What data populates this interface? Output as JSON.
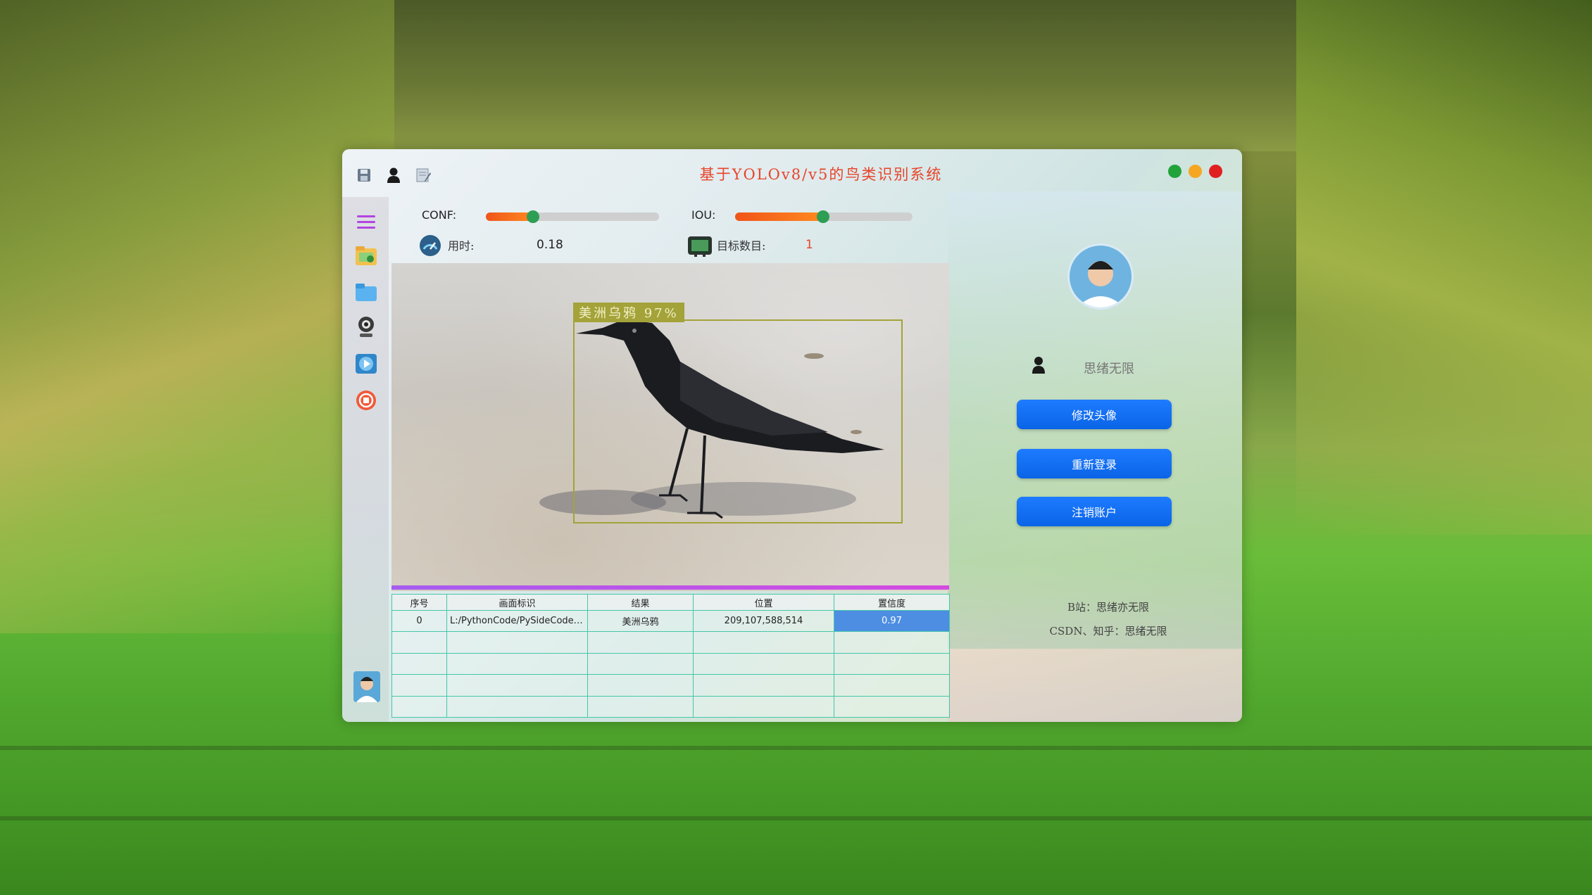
{
  "window": {
    "title": "基于YOLOv8/v5的鸟类识别系统",
    "controls": {
      "green": "#21a33a",
      "yellow": "#f5a623",
      "red": "#e02020"
    }
  },
  "toolbar": {
    "icons": [
      "save-icon",
      "user-icon",
      "edit-icon"
    ]
  },
  "sidebar": {
    "items": [
      "menu-icon",
      "image-folder-icon",
      "folder-icon",
      "webcam-icon",
      "video-play-icon",
      "stop-icon"
    ]
  },
  "params": {
    "conf_label": "CONF:",
    "conf_value": 0.25,
    "iou_label": "IOU:",
    "iou_value": 0.5
  },
  "stats": {
    "time_label": "用时:",
    "time_value": "0.18",
    "count_label": "目标数目:",
    "count_value": "1"
  },
  "detection": {
    "label": "美洲乌鸦 97%",
    "box_color": "#a3a33a"
  },
  "table": {
    "headers": [
      "序号",
      "画面标识",
      "结果",
      "位置",
      "置信度"
    ],
    "rows": [
      [
        "0",
        "L:/PythonCode/PySideCode/...",
        "美洲乌鸦",
        "209,107,588,514",
        "0.97"
      ]
    ]
  },
  "profile": {
    "username": "思绪无限",
    "buttons": [
      "修改头像",
      "重新登录",
      "注销账户"
    ],
    "info": [
      "B站：思绪亦无限",
      "CSDN、知乎：思绪无限"
    ],
    "accent": "#1e7bff"
  }
}
